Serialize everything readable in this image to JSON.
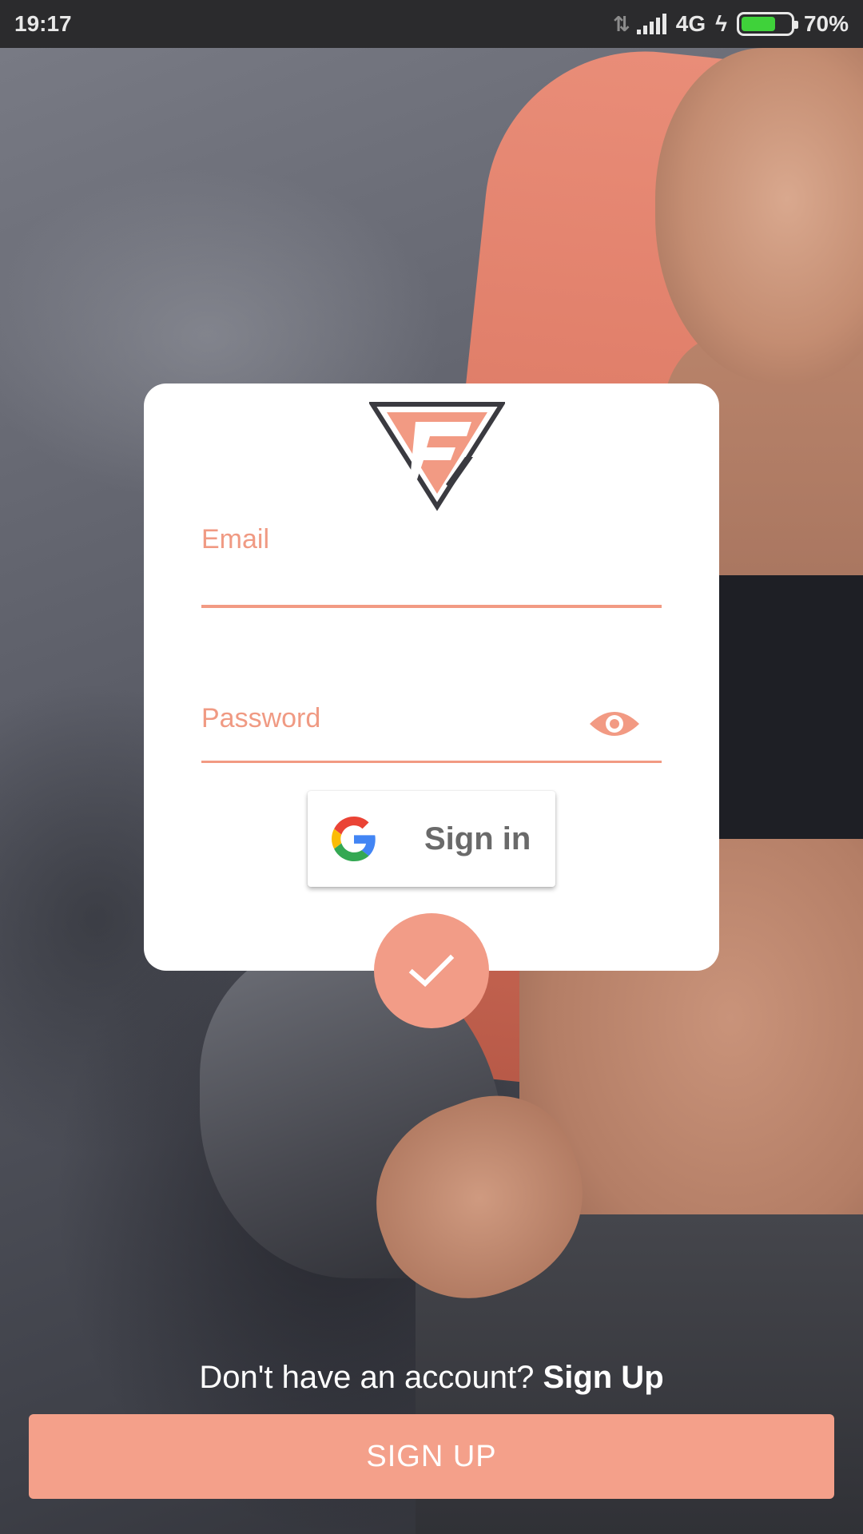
{
  "status_bar": {
    "time": "19:17",
    "network": "4G",
    "battery_percent": "70%",
    "battery_level": 0.7,
    "icons": [
      "data-arrows-icon",
      "signal-icon",
      "charging-icon",
      "battery-icon"
    ]
  },
  "colors": {
    "accent": "#f29a83",
    "accent_button": "#f4a08a",
    "status_bar_bg": "#2b2b2d",
    "card_bg": "#ffffff"
  },
  "login_card": {
    "logo": "triangle-f-logo",
    "email": {
      "label": "Email",
      "value": ""
    },
    "password": {
      "label": "Password",
      "value": "",
      "toggle_icon": "eye-icon"
    },
    "google_button": {
      "label": "Sign in",
      "icon": "google-logo-icon"
    },
    "submit_icon": "checkmark-icon"
  },
  "footer": {
    "prompt": "Don't have an account?",
    "link": "Sign Up",
    "button_label": "SIGN UP"
  }
}
